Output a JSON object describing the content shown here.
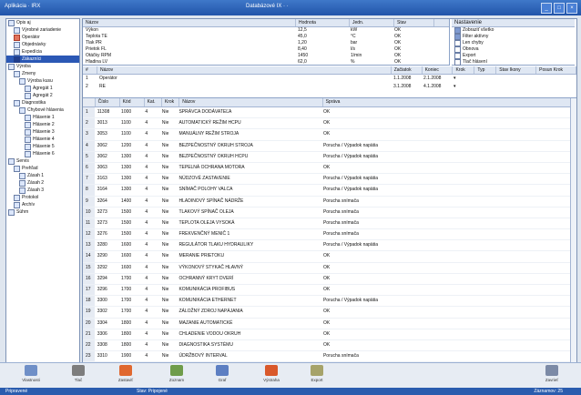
{
  "window": {
    "app_name": "Aplikácia · IRX",
    "center_title": "Databázové IX · ·",
    "controls": [
      "_",
      "□",
      "×"
    ]
  },
  "tree": {
    "items": [
      {
        "label": "Opis aj",
        "icon": "folder-icon",
        "depth": 0
      },
      {
        "label": "Výrobné zariadenie",
        "icon": "folder-icon",
        "depth": 1
      },
      {
        "label": "Operátor",
        "icon": "red-folder-icon",
        "depth": 1
      },
      {
        "label": "Objednávky",
        "icon": "folder-icon",
        "depth": 1
      },
      {
        "label": "Expedícia",
        "icon": "folder-icon",
        "depth": 1
      },
      {
        "label": "Zákazníci",
        "icon": "folder-icon",
        "depth": 1,
        "selected": true
      },
      {
        "label": "Výroba",
        "icon": "folder-icon",
        "depth": 0
      },
      {
        "label": "Zmeny",
        "icon": "folder-icon",
        "depth": 1
      },
      {
        "label": "Výroba kusu",
        "icon": "folder-icon",
        "depth": 2
      },
      {
        "label": "Agregát 1",
        "icon": "doc-icon",
        "depth": 3
      },
      {
        "label": "Agregát 2",
        "icon": "doc-icon",
        "depth": 3
      },
      {
        "label": "Diagnostika",
        "icon": "folder-icon",
        "depth": 1
      },
      {
        "label": "Chybové hlásenia",
        "icon": "folder-icon",
        "depth": 2
      },
      {
        "label": "Hlásenie 1",
        "icon": "doc-icon",
        "depth": 3
      },
      {
        "label": "Hlásenie 2",
        "icon": "doc-icon",
        "depth": 3
      },
      {
        "label": "Hlásenie 3",
        "icon": "doc-icon",
        "depth": 3
      },
      {
        "label": "Hlásenie 4",
        "icon": "doc-icon",
        "depth": 3
      },
      {
        "label": "Hlásenie 5",
        "icon": "doc-icon",
        "depth": 3
      },
      {
        "label": "Hlásenie 6",
        "icon": "doc-icon",
        "depth": 3
      },
      {
        "label": "Servis",
        "icon": "folder-icon",
        "depth": 0
      },
      {
        "label": "Prehľad",
        "icon": "folder-icon",
        "depth": 1
      },
      {
        "label": "Zásah 1",
        "icon": "doc-icon",
        "depth": 2
      },
      {
        "label": "Zásah 2",
        "icon": "doc-icon",
        "depth": 2
      },
      {
        "label": "Zásah 3",
        "icon": "doc-icon",
        "depth": 2
      },
      {
        "label": "Protokol",
        "icon": "doc-icon",
        "depth": 1
      },
      {
        "label": "Archív",
        "icon": "doc-icon",
        "depth": 1
      },
      {
        "label": "Súhrn",
        "icon": "doc-icon",
        "depth": 0
      }
    ]
  },
  "toplist": {
    "headers": [
      "Názov",
      "Hodnota",
      "Jedn.",
      "Stav"
    ],
    "rows": [
      [
        "Výkon",
        "12,5",
        "kW",
        "OK"
      ],
      [
        "Teplota TE",
        "45,0",
        "°C",
        "OK"
      ],
      [
        "Tlak PR",
        "1,20",
        "bar",
        "OK"
      ],
      [
        "Prietok FL",
        "8,40",
        "l/s",
        "OK"
      ],
      [
        "Otáčky RPM",
        "1450",
        "1/min",
        "OK"
      ],
      [
        "Hladina LV",
        "62,0",
        "%",
        "OK"
      ]
    ]
  },
  "options": {
    "header": "Nastavenie",
    "items": [
      {
        "label": "Zobraziť všetko",
        "checked": true
      },
      {
        "label": "Filter aktívny",
        "checked": true
      },
      {
        "label": "Len chyby",
        "checked": false
      },
      {
        "label": "Obnova",
        "checked": false
      },
      {
        "label": "Export",
        "checked": false
      },
      {
        "label": "Tlač hlásení",
        "checked": false
      }
    ]
  },
  "mid": {
    "headers": [
      "#",
      "Názov",
      "Začiatok",
      "Koniec",
      "Krok",
      "Typ",
      "Stav Ikony",
      "Posun Krok"
    ],
    "rows": [
      [
        "1",
        "Operátor",
        "1.1.2008",
        "2.1.2008",
        "▾",
        "",
        "",
        ""
      ],
      [
        "2",
        "RE",
        "3.1.2008",
        "4.1.2008",
        "▾",
        "",
        "",
        ""
      ]
    ]
  },
  "table": {
    "headers": [
      "",
      "Číslo",
      "Kód",
      "Kat.",
      "Krok",
      "Názov",
      "Správa"
    ],
    "rows": [
      [
        "1",
        "11308",
        "1000",
        "4",
        "Nie",
        "SPRÁVCA DODÁVATEĽA",
        "OK"
      ],
      [
        "2",
        "3013",
        "1100",
        "4",
        "Nie",
        "AUTOMATICKÝ REŽIM HCPU",
        "OK"
      ],
      [
        "3",
        "3053",
        "1100",
        "4",
        "Nie",
        "MANUÁLNY REŽIM STROJA",
        "OK"
      ],
      [
        "4",
        "3062",
        "1200",
        "4",
        "Nie",
        "BEZPEČNOSTNÝ OKRUH STROJA",
        "Porucha / Výpadok napätia"
      ],
      [
        "5",
        "3062",
        "1300",
        "4",
        "Nie",
        "BEZPEČNOSTNÝ OKRUH HCPU",
        "Porucha / Výpadok napätia"
      ],
      [
        "6",
        "3063",
        "1300",
        "4",
        "Nie",
        "TEPELNÁ OCHRANA MOTORA",
        "OK"
      ],
      [
        "7",
        "3163",
        "1300",
        "4",
        "Nie",
        "NÚDZOVÉ ZASTAVENIE",
        "Porucha / Výpadok napätia"
      ],
      [
        "8",
        "3164",
        "1300",
        "4",
        "Nie",
        "SNÍMAČ POLOHY VALCA",
        "Porucha / Výpadok napätia"
      ],
      [
        "9",
        "3264",
        "1400",
        "4",
        "Nie",
        "HLADINOVÝ SPÍNAČ NÁDRŽE",
        "Porucha snímača"
      ],
      [
        "10",
        "3273",
        "1500",
        "4",
        "Nie",
        "TLAKOVÝ SPÍNAČ OLEJA",
        "Porucha snímača"
      ],
      [
        "11",
        "3273",
        "1500",
        "4",
        "Nie",
        "TEPLOTA OLEJA VYSOKÁ",
        "Porucha snímača"
      ],
      [
        "12",
        "3276",
        "1500",
        "4",
        "Nie",
        "FREKVENČNÝ MENIČ 1",
        "Porucha snímača"
      ],
      [
        "13",
        "3280",
        "1600",
        "4",
        "Nie",
        "REGULÁTOR TLAKU HYDRAULIKY",
        "Porucha / Výpadok napätia"
      ],
      [
        "14",
        "3290",
        "1600",
        "4",
        "Nie",
        "MERANIE PRIETOKU",
        "OK"
      ],
      [
        "15",
        "3292",
        "1600",
        "4",
        "Nie",
        "VÝKONOVÝ STYKAČ HLAVNÝ",
        "OK"
      ],
      [
        "16",
        "3294",
        "1700",
        "4",
        "Nie",
        "OCHRANNÝ KRYT DVERÍ",
        "OK"
      ],
      [
        "17",
        "3296",
        "1700",
        "4",
        "Nie",
        "KOMUNIKÁCIA PROFIBUS",
        "OK"
      ],
      [
        "18",
        "3300",
        "1700",
        "4",
        "Nie",
        "KOMUNIKÁCIA ETHERNET",
        "Porucha / Výpadok napätia"
      ],
      [
        "19",
        "3302",
        "1700",
        "4",
        "Nie",
        "ZÁLOŽNÝ ZDROJ NAPÁJANIA",
        "OK"
      ],
      [
        "20",
        "3304",
        "1800",
        "4",
        "Nie",
        "MAZANIE AUTOMATICKÉ",
        "OK"
      ],
      [
        "21",
        "3306",
        "1800",
        "4",
        "Nie",
        "CHLADENIE VODOU OKRUH",
        "OK"
      ],
      [
        "22",
        "3308",
        "1800",
        "4",
        "Nie",
        "DIAGNOSTIKA SYSTÉMU",
        "OK"
      ],
      [
        "23",
        "3310",
        "1900",
        "4",
        "Nie",
        "ÚDRŽBOVÝ INTERVAL",
        "Porucha snímača"
      ],
      [
        "24",
        "3312",
        "1900",
        "4",
        "Nie",
        "KONTROLA VÝSTUPU",
        "OK"
      ],
      [
        "25",
        "3314",
        "1900",
        "4",
        "Nie",
        "ZÁZNAM UDALOSTÍ",
        "OK"
      ]
    ]
  },
  "toolbar": {
    "buttons": [
      {
        "label": "Vlastnosti",
        "icon": "wrench-icon",
        "color": "#6f8fc7"
      },
      {
        "label": "Tlač",
        "icon": "printer-icon",
        "color": "#7d7d7d"
      },
      {
        "label": "Zastaviť",
        "icon": "stop-icon",
        "color": "#e0682f"
      },
      {
        "label": "Zoznam",
        "icon": "list-icon",
        "color": "#6f9c4a"
      },
      {
        "label": "Graf",
        "icon": "chart-icon",
        "color": "#5d7fc2"
      },
      {
        "label": "Výstraha",
        "icon": "alert-icon",
        "color": "#d9582a"
      },
      {
        "label": "Export",
        "icon": "export-icon",
        "color": "#a6a36a"
      },
      {
        "label": "Zavrieť",
        "icon": "close-icon",
        "color": "#7c8aa6"
      }
    ]
  },
  "status": {
    "left": "Pripravené",
    "middle": "Stav: Pripojené",
    "right": "Záznamov: 25"
  }
}
